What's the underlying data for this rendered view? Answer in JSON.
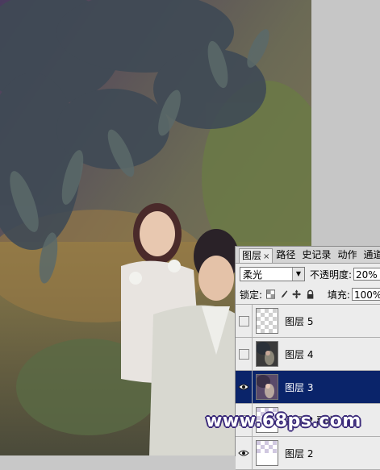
{
  "layers_panel": {
    "tabs": [
      {
        "label": "图层",
        "close": "×",
        "active": true
      },
      {
        "label": "路径",
        "active": false
      },
      {
        "label": "史记录",
        "active": false
      },
      {
        "label": "动作",
        "active": false
      },
      {
        "label": "通道",
        "active": false
      }
    ],
    "blend_mode": "柔光",
    "opacity_label": "不透明度:",
    "opacity_value": "20%",
    "lock_label": "锁定:",
    "fill_label": "填充:",
    "fill_value": "100%",
    "layers": [
      {
        "name": "图层 5",
        "visible": false,
        "selected": false,
        "thumb": "transparent-checker"
      },
      {
        "name": "图层 4",
        "visible": false,
        "selected": false,
        "thumb": "dark-photo"
      },
      {
        "name": "图层 3",
        "visible": true,
        "selected": true,
        "thumb": "purple-photo"
      },
      {
        "name": "图层 2 副本",
        "visible": false,
        "selected": false,
        "thumb": "transparent-checker"
      },
      {
        "name": "图层 2",
        "visible": true,
        "selected": false,
        "thumb": "transparent-checker"
      }
    ]
  },
  "watermark": "www.68ps.com",
  "icons": {
    "eye": "eye-icon",
    "lock_transparent": "checkerboard-lock-icon",
    "lock_brush": "brush-lock-icon",
    "lock_move": "move-lock-icon",
    "lock_all": "padlock-icon",
    "dropdown": "chevron-down-icon"
  },
  "colors": {
    "selection": "#0a246a",
    "panel_bg": "#ececec",
    "canvas_surround": "#c6c6c6",
    "watermark_outline": "#3b2a7a"
  }
}
